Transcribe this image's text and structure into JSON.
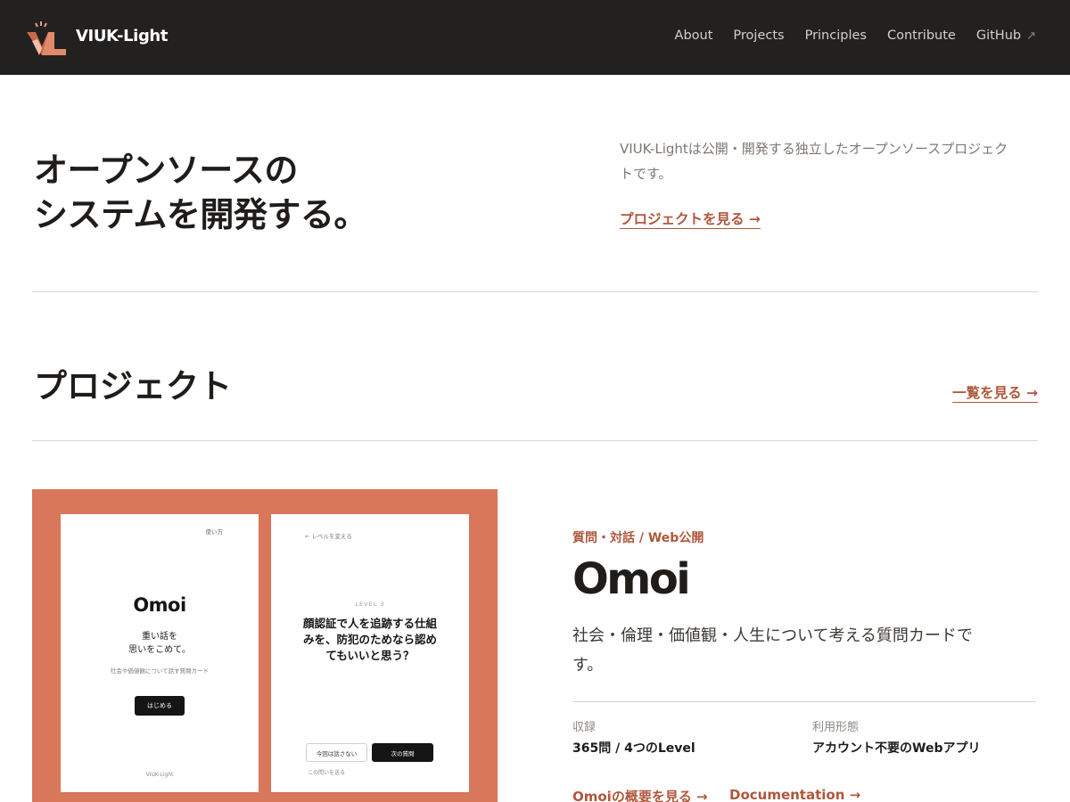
{
  "header": {
    "brand": "VIUK-Light",
    "logo_icon": "viuk-light-logo",
    "nav": [
      "About",
      "Projects",
      "Principles",
      "Contribute",
      "GitHub"
    ],
    "external_icon": "↗"
  },
  "hero": {
    "title_line1": "オープンソースの",
    "title_line2": "システムを開発する。",
    "description": "VIUK-Lightは公開・開発する独立したオープンソースプロジェクトです。",
    "link": "プロジェクトを見る →"
  },
  "projects": {
    "title": "プロジェクト",
    "view_all": "一覧を見る →"
  },
  "project": {
    "category": "質問・対話 / Web公開",
    "name": "Omoi",
    "description": "社会・倫理・価値観・人生について考える質問カードです。",
    "meta": [
      {
        "label": "収録",
        "value": "365問 / 4つのLevel"
      },
      {
        "label": "利用形態",
        "value": "アカウント不要のWebアプリ"
      }
    ],
    "links": [
      "Omoiの概要を見る →",
      "Documentation →"
    ],
    "preview": {
      "card1": {
        "help": "使い方",
        "title": "Omoi",
        "tagline_1": "重い話を",
        "tagline_2": "思いをこめて。",
        "subtitle": "社会や価値観について話す質問カード",
        "start": "はじめる",
        "brand": "VIUK-Light"
      },
      "card2": {
        "back": "← レベルを変える",
        "level": "LEVEL 3",
        "question": "顔認証で人を追跡する仕組みを、防犯のためなら認めてもいいと思う？",
        "skip": "今回は話さない",
        "next": "次の質問",
        "note": "この問いを送る"
      }
    },
    "colors": {
      "accent": "#b0573c",
      "preview_bg": "#d9775a",
      "header_bg": "#232120"
    }
  }
}
